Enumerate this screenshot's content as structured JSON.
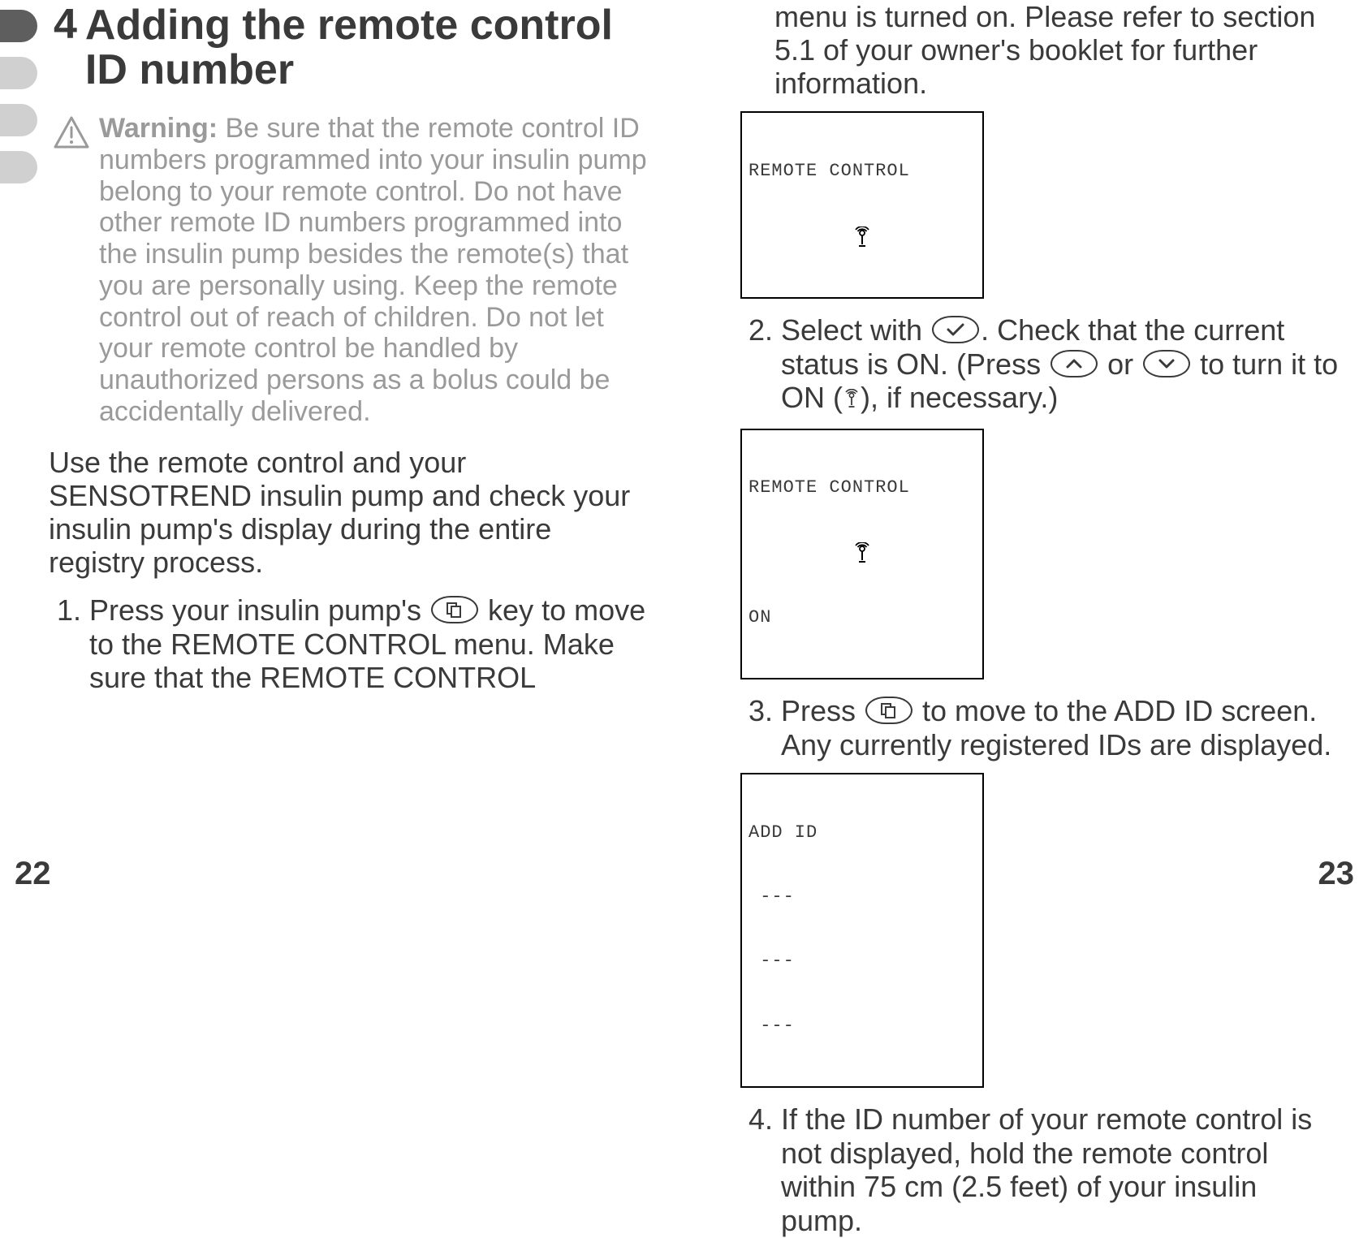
{
  "left": {
    "heading_num": "4",
    "heading_text": "Adding the remote control ID number",
    "warning_label": "Warning:",
    "warning_text": " Be sure that the remote control ID numbers programmed into your insulin pump belong to your remote control.  Do not have other remote ID numbers programmed into the insulin pump besides the remote(s) that you are personally using. Keep the remote control out of reach of children. Do not let your remote control be handled by unauthorized persons as a bolus could be accidentally delivered.",
    "intro": "Use the remote control and your SENSOTREND insulin pump and check your insulin pump's display during the entire registry process.",
    "step1_num": "1.",
    "step1_a": "Press your insulin pump's ",
    "step1_b": " key to move to the REMOTE CONTROL menu. Make sure that the REMOTE CONTROL",
    "page_num": "22"
  },
  "right": {
    "cont": "menu is turned on. Please refer to section 5.1 of your owner's booklet for further information.",
    "lcd1_title": "REMOTE CONTROL",
    "step2_num": "2.",
    "step2_a": "Select with ",
    "step2_b": ". Check that the current status is ON. (Press ",
    "step2_c": " or ",
    "step2_d": " to turn it to ON (",
    "step2_e": "), if necessary.)",
    "lcd2_title": "REMOTE CONTROL",
    "lcd2_status": "ON",
    "step3_num": "3.",
    "step3_a": "Press ",
    "step3_b": " to move to the ADD ID screen. Any currently registered IDs are displayed.",
    "lcd3_title": "ADD ID",
    "lcd3_l1": " ---",
    "lcd3_l2": " ---",
    "lcd3_l3": " ---",
    "step4_num": "4.",
    "step4": "If the ID number of your remote control is not displayed, hold the remote control within 75 cm (2.5 feet) of your insulin pump.",
    "page_num": "23"
  }
}
